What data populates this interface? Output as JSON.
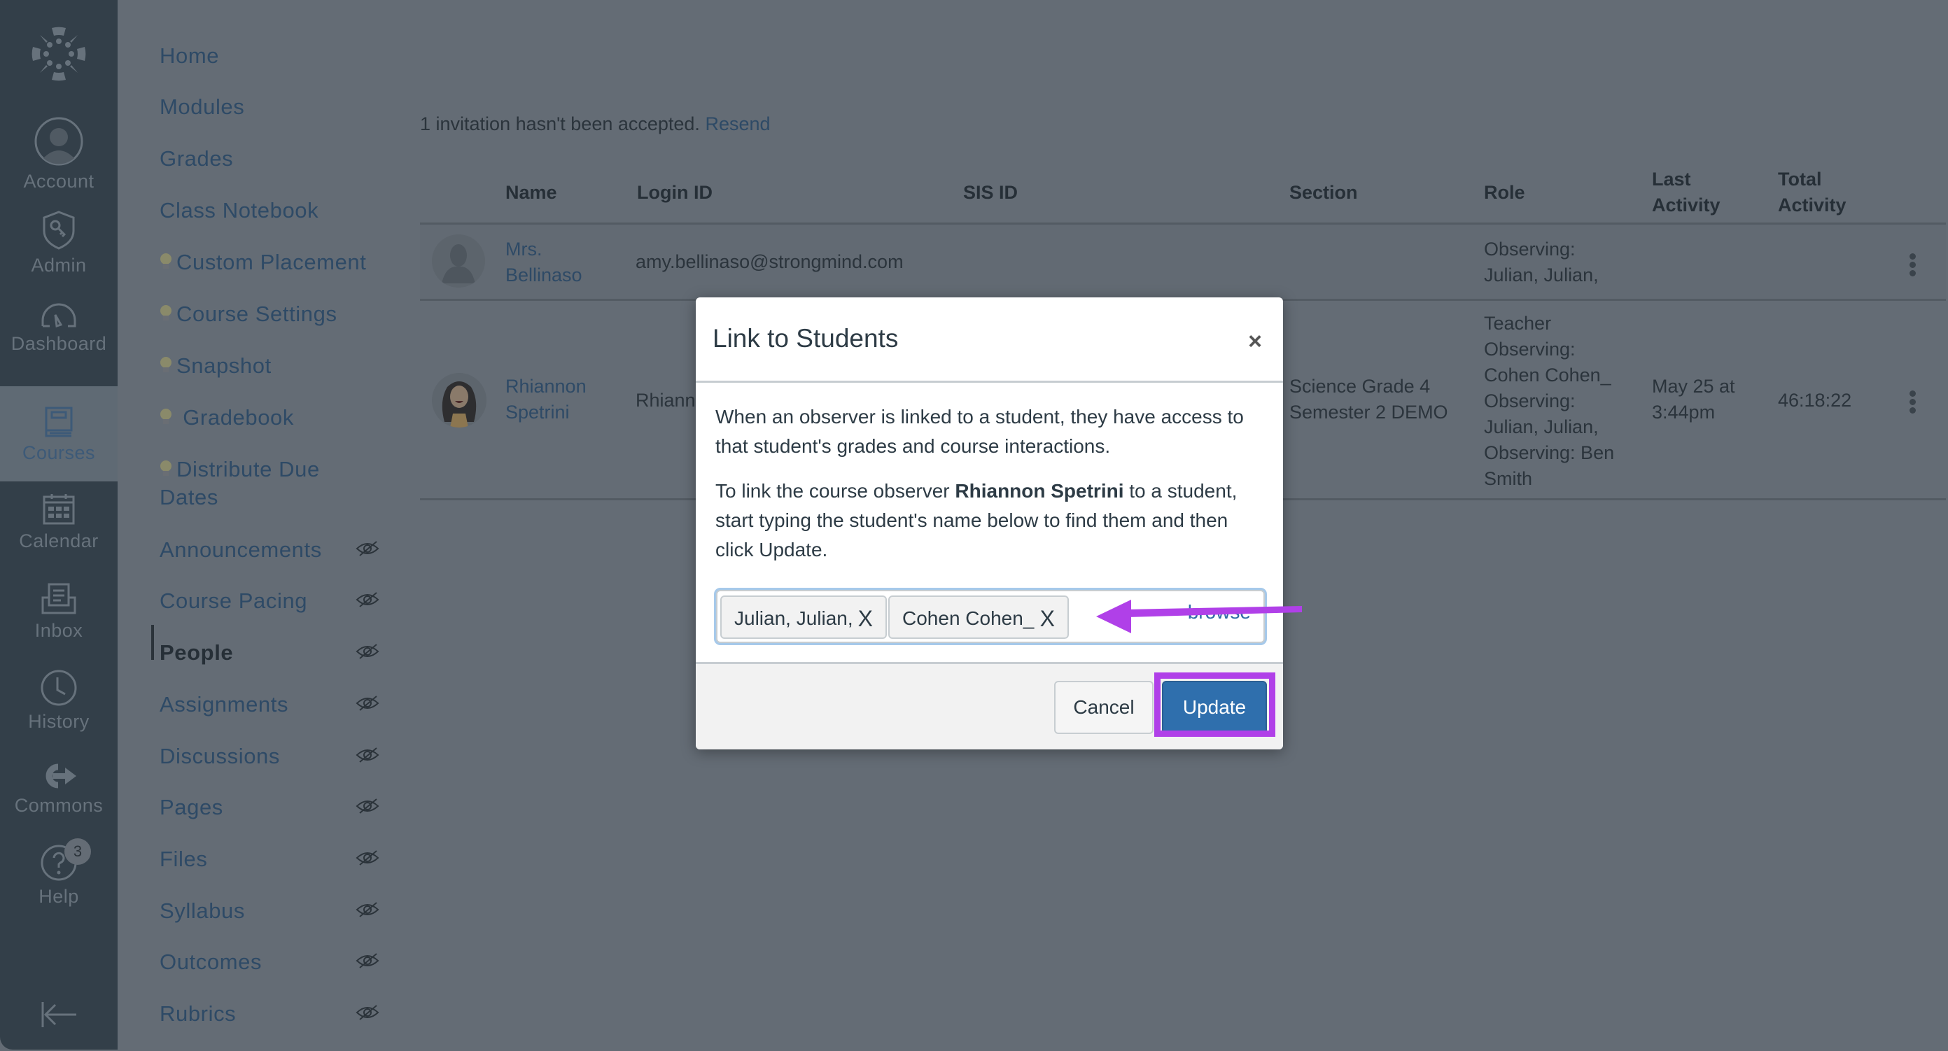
{
  "global_nav": {
    "items": [
      {
        "key": "logo",
        "label": ""
      },
      {
        "key": "account",
        "label": "Account"
      },
      {
        "key": "admin",
        "label": "Admin"
      },
      {
        "key": "dashboard",
        "label": "Dashboard"
      },
      {
        "key": "courses",
        "label": "Courses",
        "active": true
      },
      {
        "key": "calendar",
        "label": "Calendar"
      },
      {
        "key": "inbox",
        "label": "Inbox"
      },
      {
        "key": "history",
        "label": "History"
      },
      {
        "key": "commons",
        "label": "Commons"
      },
      {
        "key": "help",
        "label": "Help",
        "badge": "3"
      }
    ],
    "collapse_icon": "collapse-arrow-icon"
  },
  "course_nav": {
    "items": [
      {
        "label": "Home",
        "icon": null,
        "hidden": false
      },
      {
        "label": "Modules",
        "icon": null,
        "hidden": false
      },
      {
        "label": "Grades",
        "icon": null,
        "hidden": false
      },
      {
        "label": "Class Notebook",
        "icon": null,
        "hidden": false
      },
      {
        "label": "Custom Placement",
        "icon": "lightbulb-icon",
        "hidden": false
      },
      {
        "label": "Course Settings",
        "icon": "lightbulb-icon",
        "hidden": false
      },
      {
        "label": "Snapshot",
        "icon": "lightbulb-icon",
        "hidden": false
      },
      {
        "label": " Gradebook",
        "icon": "lightbulb-icon",
        "hidden": false
      },
      {
        "label": "Distribute Due",
        "label2": "Dates",
        "icon": "lightbulb-icon",
        "hidden": false
      },
      {
        "label": "Announcements",
        "hidden": true
      },
      {
        "label": "Course Pacing",
        "hidden": true
      },
      {
        "label": "People",
        "hidden": true,
        "active": true
      },
      {
        "label": "Assignments",
        "hidden": true
      },
      {
        "label": "Discussions",
        "hidden": true
      },
      {
        "label": "Pages",
        "hidden": true
      },
      {
        "label": "Files",
        "hidden": true
      },
      {
        "label": "Syllabus",
        "hidden": true
      },
      {
        "label": "Outcomes",
        "hidden": true
      },
      {
        "label": "Rubrics",
        "hidden": true
      }
    ]
  },
  "people": {
    "invitation_text": "1 invitation hasn't been accepted.",
    "resend_label": "Resend",
    "columns": [
      "Name",
      "Login ID",
      "SIS ID",
      "Section",
      "Role",
      "Last Activity",
      "Total Activity"
    ],
    "column_lines": {
      "last_activity": [
        "Last",
        "Activity"
      ],
      "total_activity": [
        "Total",
        "Activity"
      ]
    },
    "rows": [
      {
        "name_lines": [
          "Mrs.",
          "Bellinaso"
        ],
        "login_id": "amy.bellinaso@strongmind.com",
        "sis_id": "",
        "section_lines": [],
        "role_lines": [
          "Observing:",
          "Julian, Julian,"
        ],
        "last_activity_lines": [],
        "total_activity": ""
      },
      {
        "name_lines": [
          "Rhiannon",
          "Spetrini"
        ],
        "login_id": "Rhiann",
        "sis_id": "",
        "section_lines": [
          "Science Grade 4",
          "Semester 2 DEMO"
        ],
        "role_lines": [
          "Teacher",
          "Observing:",
          "Cohen Cohen_",
          "Observing:",
          "Julian, Julian,",
          "Observing: Ben",
          "Smith"
        ],
        "last_activity_lines": [
          "May 25 at",
          "3:44pm"
        ],
        "total_activity": "46:18:22"
      }
    ]
  },
  "modal": {
    "title": "Link to Students",
    "close_label": "×",
    "para1": "When an observer is linked to a student, they have access to that student's grades and course interactions.",
    "para2_before": "To link the course observer ",
    "para2_bold": "Rhiannon Spetrini",
    "para2_after": " to a student, start typing the student's name below to find them and then click Update.",
    "selected_students": [
      "Julian, Julian,",
      "Cohen Cohen_"
    ],
    "chip_remove_label": "X",
    "browse_label": "browse",
    "cancel_label": "Cancel",
    "update_label": "Update"
  },
  "annotation": {
    "color": "#b040e8",
    "highlight_target": "update-button",
    "arrow_target": "student-input"
  }
}
